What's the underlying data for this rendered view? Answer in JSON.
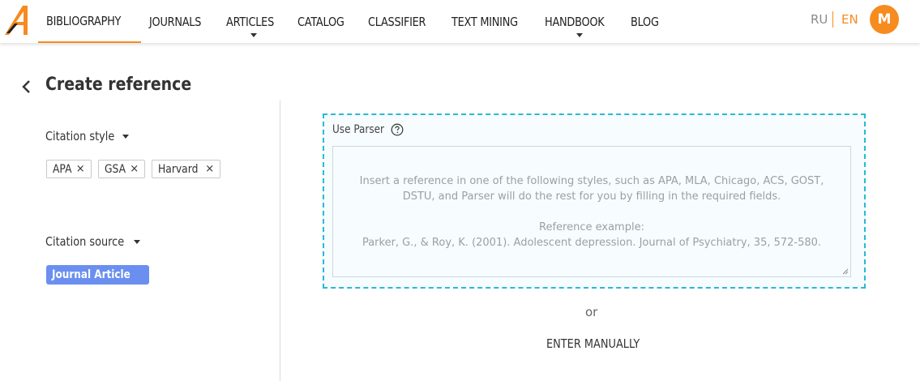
{
  "header": {
    "nav": [
      {
        "label": "BIBLIOGRAPHY",
        "active": true,
        "dropdown": false
      },
      {
        "label": "JOURNALS",
        "active": false,
        "dropdown": false
      },
      {
        "label": "ARTICLES",
        "active": false,
        "dropdown": true
      },
      {
        "label": "CATALOG",
        "active": false,
        "dropdown": false
      },
      {
        "label": "CLASSIFIER",
        "active": false,
        "dropdown": false
      },
      {
        "label": "TEXT MINING",
        "active": false,
        "dropdown": false
      },
      {
        "label": "HANDBOOK",
        "active": false,
        "dropdown": true
      },
      {
        "label": "BLOG",
        "active": false,
        "dropdown": false
      }
    ],
    "lang_ru": "RU",
    "lang_en": "EN",
    "avatar_initial": "M"
  },
  "page": {
    "title": "Create reference"
  },
  "citation_style": {
    "label": "Citation style",
    "chips": [
      "APA",
      "GSA",
      "Harvard"
    ],
    "remove_glyph": "×"
  },
  "citation_source": {
    "label": "Citation source",
    "selected": "Journal Article"
  },
  "parser": {
    "label": "Use Parser",
    "placeholder_line1": "Insert a reference in one of the following styles, such as APA, MLA, Chicago, ACS, GOST,",
    "placeholder_line2": "DSTU, and Parser will do the rest for you by filling in the required fields.",
    "example_title": "Reference example:",
    "example_text": "Parker, G., & Roy, K. (2001). Adolescent depression. Journal of Psychiatry, 35, 572-580."
  },
  "or_text": "or",
  "manual_button": "ENTER MANUALLY",
  "colors": {
    "accent": "#f68b1f",
    "parser_border": "#29b9d6",
    "source_badge": "#6b8ff0"
  }
}
